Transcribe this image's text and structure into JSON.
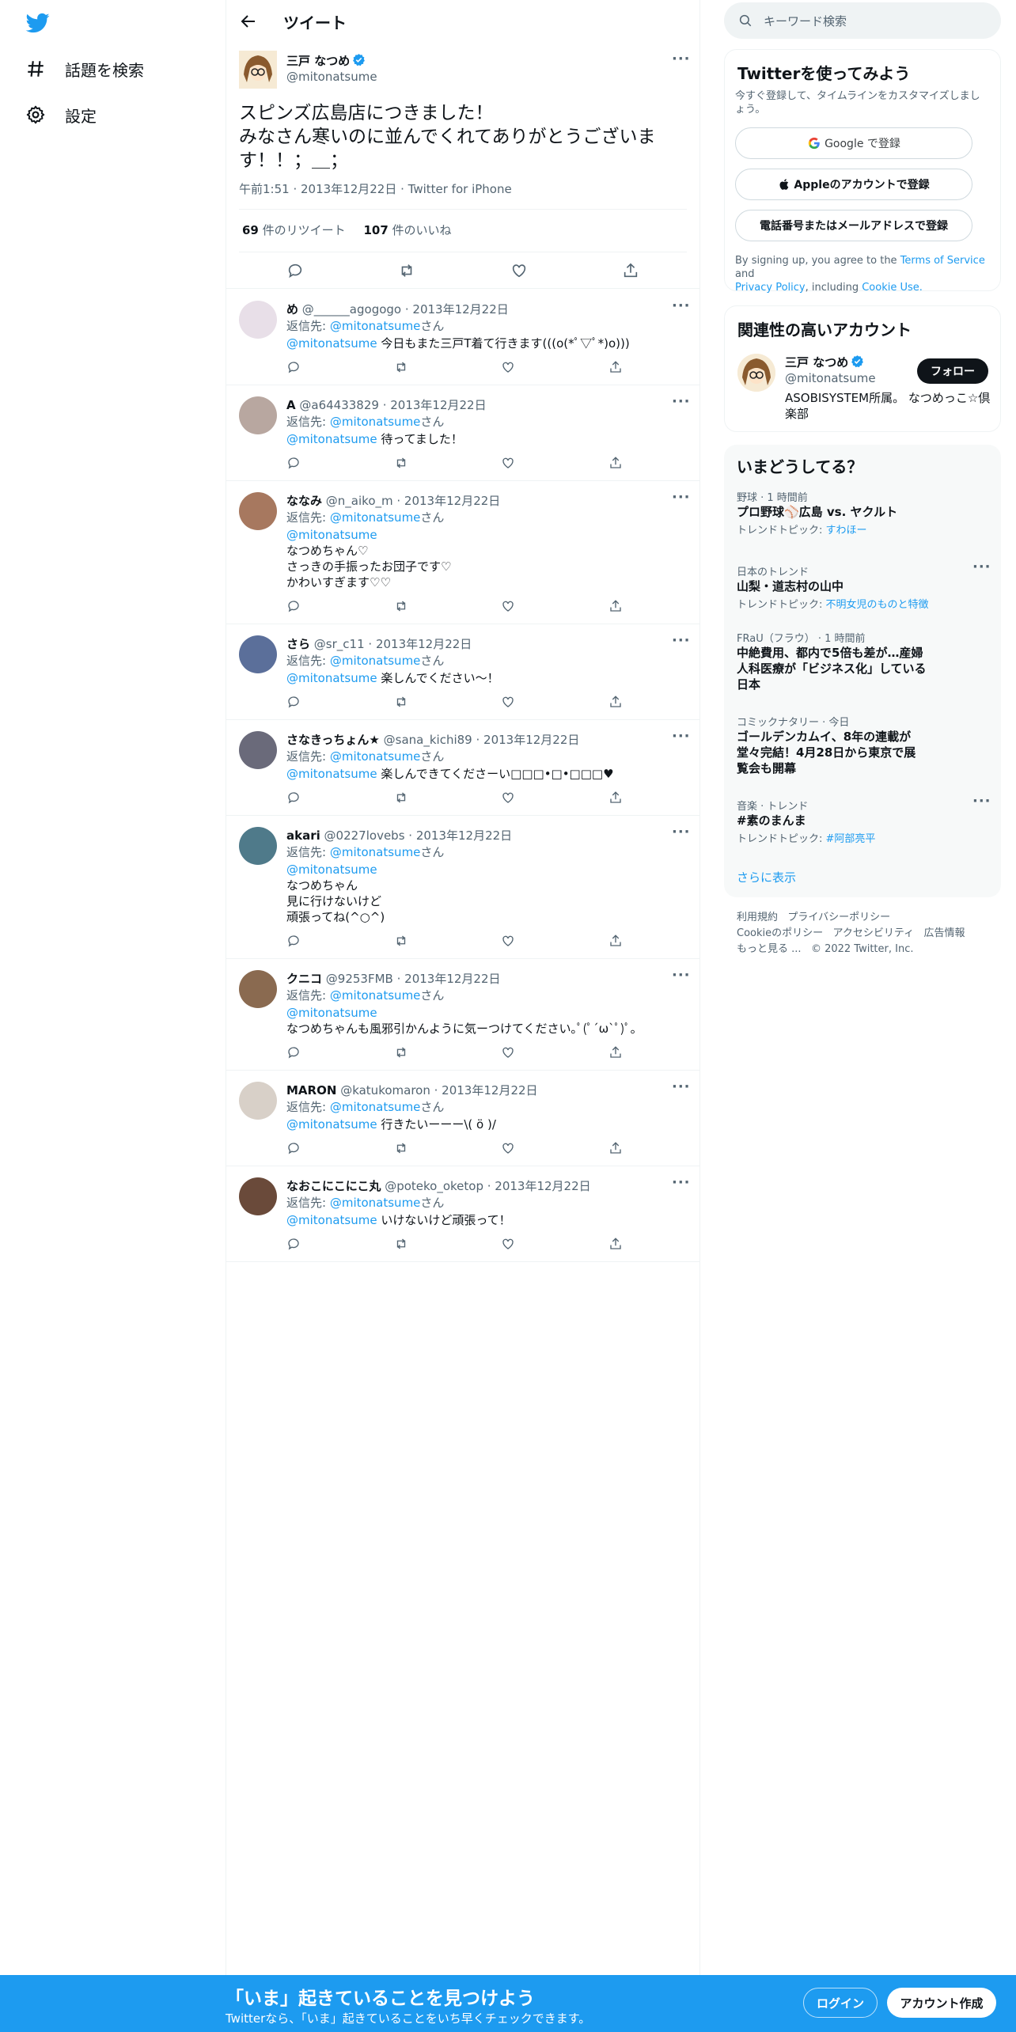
{
  "nav": {
    "items": [
      {
        "label": "話題を検索",
        "icon": "hashtag-icon"
      },
      {
        "label": "設定",
        "icon": "gear-icon"
      }
    ]
  },
  "header": {
    "title": "ツイート"
  },
  "tweet": {
    "name": "三戸 なつめ",
    "handle": "@mitonatsume",
    "text_lines": [
      "スピンズ広島店につきました！",
      "みなさん寒いのに並んでくれてありがとうございま",
      "す！！；＿；"
    ],
    "meta": "午前1:51 · 2013年12月22日 · Twitter for iPhone",
    "retweets": "69",
    "retweets_label": "件のリツイート",
    "likes": "107",
    "likes_label": "件のいいね"
  },
  "reply_prefix": "返信先: ",
  "reply_target": "@mitonatsume",
  "reply_suffix": "さん",
  "replies": [
    {
      "name": "め",
      "handle": "@______agogogo",
      "date": "· 2013年12月22日",
      "lines": [
        "今日もまた三戸T着て行きます(((o(*ﾟ▽ﾟ*)o)))"
      ],
      "mention_inline": true
    },
    {
      "name": "A",
      "handle": "@a64433829",
      "date": "· 2013年12月22日",
      "lines": [
        "待ってました！"
      ],
      "mention_inline": true
    },
    {
      "name": "ななみ",
      "handle": "@n_aiko_m",
      "date": "· 2013年12月22日",
      "lines": [
        "なつめちゃん♡",
        "さっきの手振ったお団子です♡",
        "かわいすぎます♡♡"
      ],
      "mention_inline": false
    },
    {
      "name": "さら",
      "handle": "@sr_c11",
      "date": "· 2013年12月22日",
      "lines": [
        "楽しんでください〜！"
      ],
      "mention_inline": true
    },
    {
      "name": "さなきっちょん★",
      "handle": "@sana_kichi89",
      "date": "· 2013年12月22日",
      "lines": [
        "楽しんできてくださーい□□□•□•□□□♥"
      ],
      "mention_inline": true
    },
    {
      "name": "akari",
      "handle": "@0227lovebs",
      "date": "· 2013年12月22日",
      "lines": [
        "なつめちゃん",
        "見に行けないけど",
        "頑張ってね(^○^)"
      ],
      "mention_inline": false
    },
    {
      "name": "クニコ",
      "handle": "@9253FMB",
      "date": "· 2013年12月22日",
      "lines": [
        "なつめちゃんも風邪引かんように気ーつけてください｡ﾟ(ﾟ´ω`ﾟ)ﾟ｡"
      ],
      "mention_inline": false
    },
    {
      "name": "MARON",
      "handle": "@katukomaron",
      "date": "· 2013年12月22日",
      "lines": [
        "行きたいーーー\\( ö )/"
      ],
      "mention_inline": true
    },
    {
      "name": "なおこにこにこ丸",
      "handle": "@poteko_oketop",
      "date": "· 2013年12月22日",
      "lines": [
        "いけないけど頑張って！"
      ],
      "mention_inline": true
    }
  ],
  "right": {
    "search_placeholder": "キーワード検索",
    "signup_title": "Twitterを使ってみよう",
    "signup_sub": "今すぐ登録して、タイムラインをカスタマイズしましょう。",
    "google_btn": "Google で登録",
    "apple_btn": "Appleのアカウントで登録",
    "phone_btn": "電話番号またはメールアドレスで登録",
    "terms_1": "By signing up, you agree to the ",
    "terms_link1": "Terms of Service",
    "terms_2": " and",
    "terms_link2": "Privacy Policy",
    "terms_3": ", including ",
    "terms_link3": "Cookie Use.",
    "related_title": "関連性の高いアカウント",
    "related_name": "三戸 なつめ",
    "related_handle": "@mitonatsume",
    "related_bio": "ASOBISYSTEM所属。 なつめっこ☆倶楽部",
    "follow_btn": "フォロー",
    "trends_title": "いまどうしてる？",
    "trends": [
      {
        "cat": "野球 · 1 時間前",
        "title": "プロ野球⚾広島 vs. ヤクルト",
        "sub_prefix": "トレンドトピック: ",
        "sub_link": "すわほー"
      },
      {
        "cat": "日本のトレンド",
        "title": "山梨・道志村の山中",
        "sub_prefix": "トレンドトピック: ",
        "sub_link": "不明女児のものと特徴"
      },
      {
        "cat": "FRaU（フラウ） · 1 時間前",
        "title": "中絶費用、都内で5倍も差が…産婦人科医療が「ビジネス化」している日本"
      },
      {
        "cat": "コミックナタリー · 今日",
        "title": "ゴールデンカムイ、8年の連載が堂々完結！4月28日から東京で展覧会も開幕"
      },
      {
        "cat": "音楽 · トレンド",
        "title": "#素のまんま",
        "sub_prefix": "トレンドトピック: ",
        "sub_link": "#阿部亮平"
      }
    ],
    "show_more": "さらに表示",
    "footer": [
      "利用規約",
      "プライバシーポリシー",
      "Cookieのポリシー",
      "アクセシビリティ",
      "広告情報",
      "もっと見る ...",
      "© 2022 Twitter, Inc."
    ]
  },
  "banner": {
    "title": "「いま」起きていることを見つけよう",
    "subtitle": "Twitterなら、「いま」起きていることをいち早くチェックできます。",
    "login": "ログイン",
    "signup": "アカウント作成"
  },
  "colors": {
    "accent": "#1d9bf0",
    "text": "#0f1419",
    "muted": "#536471",
    "border": "#eff3f4"
  }
}
